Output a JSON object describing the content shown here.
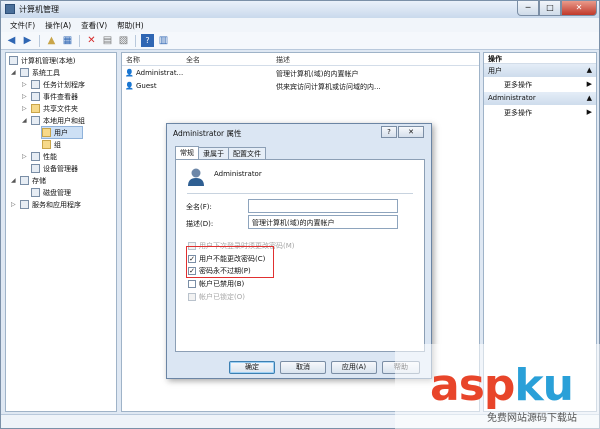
{
  "window": {
    "title": "计算机管理",
    "buttons": [
      "─",
      "□",
      "✕"
    ]
  },
  "menu": [
    "文件(F)",
    "操作(A)",
    "查看(V)",
    "帮助(H)"
  ],
  "tree": {
    "root": "计算机管理(本地)",
    "items": [
      {
        "label": "系统工具"
      },
      {
        "label": "任务计划程序"
      },
      {
        "label": "事件查看器"
      },
      {
        "label": "共享文件夹"
      },
      {
        "label": "本地用户和组"
      },
      {
        "label": "用户"
      },
      {
        "label": "组"
      },
      {
        "label": "性能"
      },
      {
        "label": "设备管理器"
      },
      {
        "label": "存储"
      },
      {
        "label": "磁盘管理"
      },
      {
        "label": "服务和应用程序"
      }
    ]
  },
  "list": {
    "headers": [
      "名称",
      "全名",
      "描述"
    ],
    "rows": [
      {
        "name": "Administrat...",
        "fullname": "",
        "desc": "管理计算机(域)的内置帐户"
      },
      {
        "name": "Guest",
        "fullname": "",
        "desc": "供来宾访问计算机或访问域的内..."
      }
    ]
  },
  "actions": {
    "header": "操作",
    "sections": [
      {
        "title": "用户",
        "item": "更多操作"
      },
      {
        "title": "Administrator",
        "item": "更多操作"
      }
    ]
  },
  "dialog": {
    "title": "Administrator 属性",
    "close": "✕",
    "help": "?",
    "tabs": [
      "常规",
      "隶属于",
      "配置文件"
    ],
    "username": "Administrator",
    "fullname_label": "全名(F):",
    "fullname_value": "",
    "desc_label": "描述(D):",
    "desc_value": "管理计算机(域)的内置帐户",
    "checkboxes": [
      {
        "label": "用户下次登录时须更改密码(M)",
        "checked": false,
        "disabled": true
      },
      {
        "label": "用户不能更改密码(C)",
        "checked": true,
        "disabled": false
      },
      {
        "label": "密码永不过期(P)",
        "checked": true,
        "disabled": false
      },
      {
        "label": "帐户已禁用(B)",
        "checked": false,
        "disabled": false
      },
      {
        "label": "帐户已锁定(O)",
        "checked": false,
        "disabled": true
      }
    ],
    "buttons": {
      "ok": "确定",
      "cancel": "取消",
      "apply": "应用(A)",
      "help": "帮助"
    }
  },
  "watermark": {
    "brand_a": "asp",
    "brand_b": "ku",
    "sub": "免费网站源码下载站"
  },
  "colors": {
    "highlight": "#e03030",
    "brand_red": "#e8452a",
    "brand_blue": "#2aa0d8"
  }
}
